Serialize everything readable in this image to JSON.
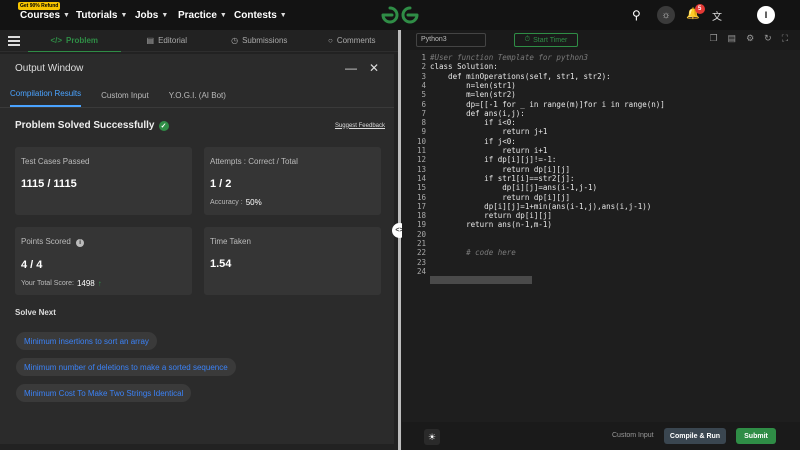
{
  "nav": {
    "refund_badge": "Get 90% Refund",
    "items": [
      "Courses",
      "Tutorials",
      "Jobs",
      "Practice",
      "Contests"
    ],
    "notifications": "5",
    "avatar_initial": "I"
  },
  "problem_tabs": [
    "Problem",
    "Editorial",
    "Submissions",
    "Comments"
  ],
  "output": {
    "title": "Output Window",
    "subtabs": [
      "Compilation Results",
      "Custom Input",
      "Y.O.G.I. (AI Bot)"
    ],
    "status": "Problem Solved Successfully",
    "feedback": "Suggest Feedback",
    "cards": {
      "tests_label": "Test Cases Passed",
      "tests_value": "1115 / 1115",
      "attempts_label": "Attempts : Correct / Total",
      "attempts_value": "1 / 2",
      "accuracy_label": "Accuracy :",
      "accuracy_value": "50%",
      "points_label": "Points Scored",
      "points_value": "4 / 4",
      "total_score_label": "Your Total Score:",
      "total_score_value": "1498",
      "time_label": "Time Taken",
      "time_value": "1.54"
    },
    "solve_next_title": "Solve Next",
    "suggestions": [
      "Minimum insertions to sort an array",
      "Minimum number of deletions to make a sorted sequence",
      "Minimum Cost To Make Two Strings Identical"
    ]
  },
  "editor": {
    "language": "Python3",
    "timer_label": "Start Timer",
    "code_lines": [
      "#User function Template for python3",
      "class Solution:",
      "    def minOperations(self, str1, str2):",
      "        n=len(str1)",
      "        m=len(str2)",
      "        dp=[[-1 for _ in range(m)]for i in range(n)]",
      "        def ans(i,j):",
      "            if i<0:",
      "                return j+1",
      "            if j<0:",
      "                return i+1",
      "            if dp[i][j]!=-1:",
      "                return dp[i][j]",
      "            if str1[i]==str2[j]:",
      "                dp[i][j]=ans(i-1,j-1)",
      "                return dp[i][j]",
      "            dp[i][j]=1+min(ans(i-1,j),ans(i,j-1))",
      "            return dp[i][j]",
      "        return ans(n-1,m-1)",
      "",
      "",
      "        # code here",
      "",
      ""
    ],
    "custom_input": "Custom Input",
    "compile_run": "Compile & Run",
    "submit": "Submit"
  }
}
